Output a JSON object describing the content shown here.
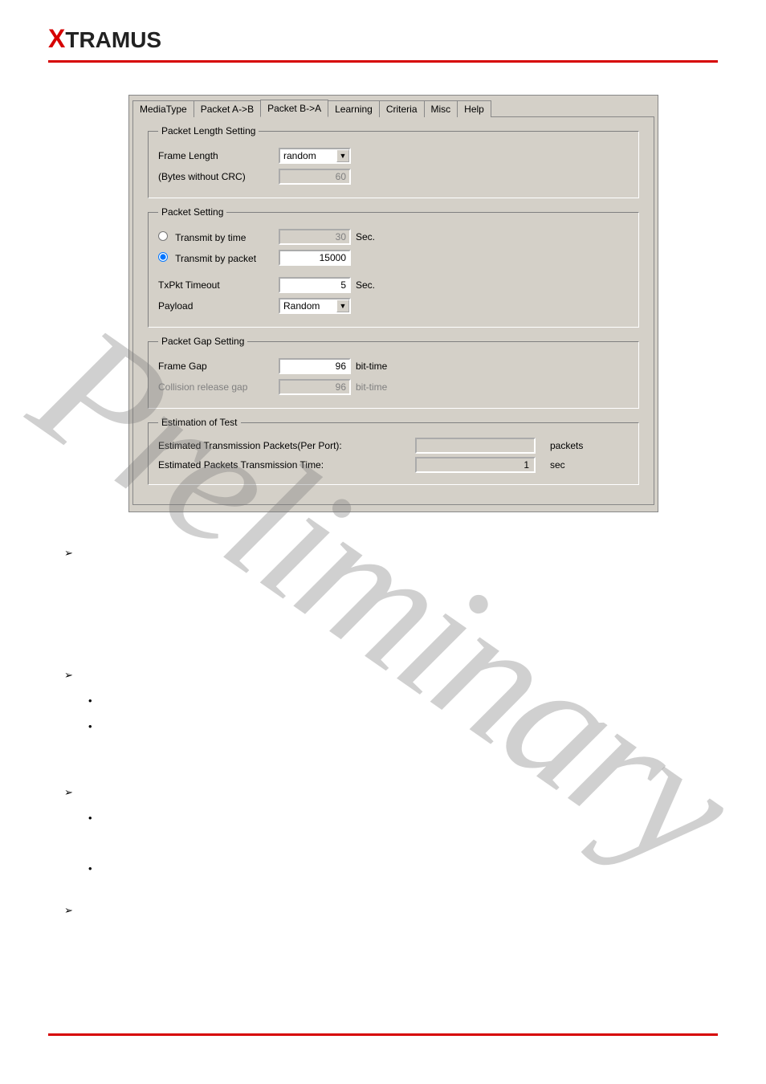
{
  "brand": {
    "prefix": "X",
    "rest": "TRAMUS"
  },
  "watermark": "Preliminary",
  "dialog": {
    "tabs": [
      "MediaType",
      "Packet A->B",
      "Packet B->A",
      "Learning",
      "Criteria",
      "Misc",
      "Help"
    ],
    "activeTabIndex": 2,
    "sections": {
      "pktLen": {
        "legend": "Packet Length Setting",
        "frameLengthLabel": "Frame Length",
        "frameLengthValue": "random",
        "bytesLabel": "(Bytes without CRC)",
        "bytesValue": "60"
      },
      "pktSet": {
        "legend": "Packet Setting",
        "byTimeLabel": "Transmit by time",
        "byTimeValue": "30",
        "byTimeUnit": "Sec.",
        "byPacketLabel": "Transmit by packet",
        "byPacketValue": "15000",
        "txPktTimeoutLabel": "TxPkt Timeout",
        "txPktTimeoutValue": "5",
        "txPktTimeoutUnit": "Sec.",
        "payloadLabel": "Payload",
        "payloadValue": "Random"
      },
      "gap": {
        "legend": "Packet Gap Setting",
        "frameGapLabel": "Frame Gap",
        "frameGapValue": "96",
        "frameGapUnit": "bit-time",
        "collisionLabel": "Collision release gap",
        "collisionValue": "96",
        "collisionUnit": "bit-time"
      },
      "est": {
        "legend": "Estimation of Test",
        "pktsLabel": "Estimated Transmission Packets(Per Port):",
        "pktsValue": "",
        "pktsUnit": "packets",
        "timeLabel": "Estimated Packets Transmission Time:",
        "timeValue": "1",
        "timeUnit": "sec"
      }
    }
  },
  "glyphs": {
    "chev": "➢",
    "dot": "•",
    "dd": "▼"
  }
}
